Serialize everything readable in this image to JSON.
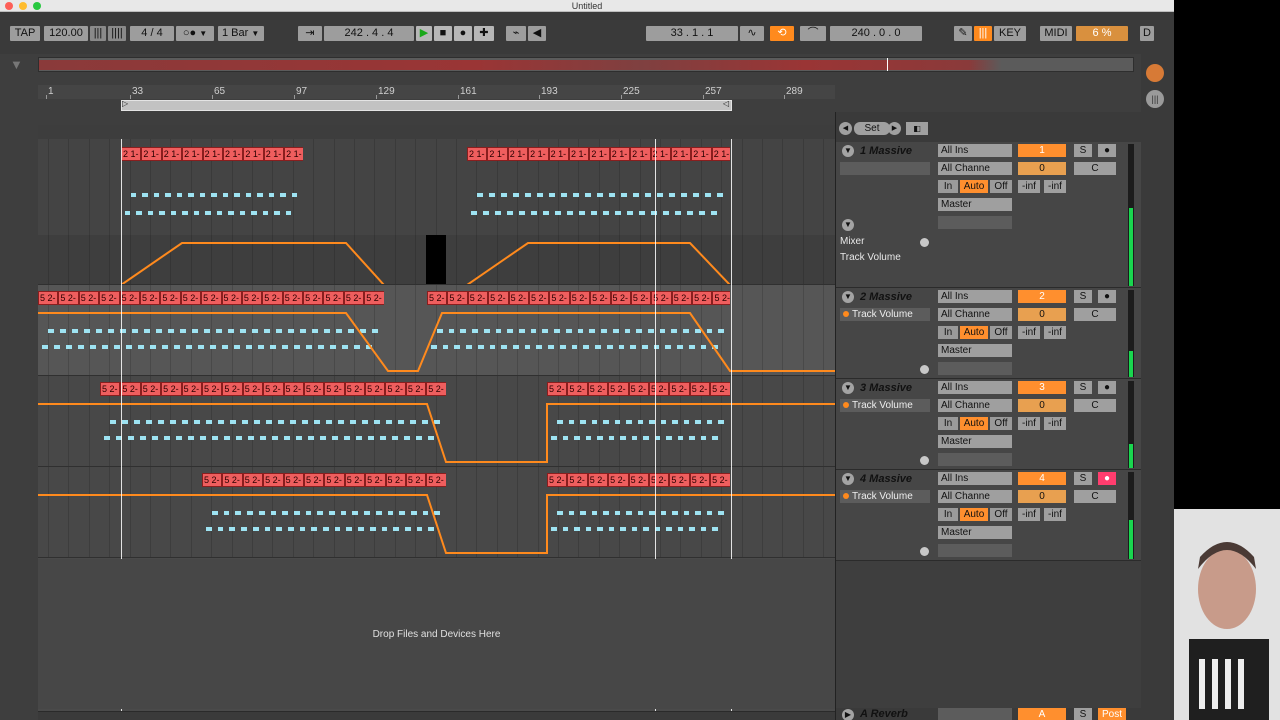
{
  "window": {
    "title": "Untitled"
  },
  "control_bar": {
    "tap": "TAP",
    "tempo": "120.00",
    "signature": "4 / 4",
    "metronome": "",
    "quantize": "1 Bar",
    "arrangement_position": "242 .  4 .  4",
    "punch_in": "33 .  1 .  1",
    "loop_length": "240 .  0 .  0",
    "key": "KEY",
    "midi": "MIDI",
    "cpu": "6 %",
    "d": "D"
  },
  "ruler": {
    "ticks": [
      "1",
      "33",
      "65",
      "97",
      "129",
      "161",
      "193",
      "225",
      "257",
      "289"
    ]
  },
  "tracks": [
    {
      "name": "1 Massive",
      "clip_label": "2 1-",
      "input": "All Ins",
      "channel": "All Channe",
      "monitor": [
        "In",
        "Auto",
        "Off"
      ],
      "output": "Master",
      "number": "1",
      "volume": "0",
      "pan": "C",
      "solo": "S",
      "peak_left": "-inf",
      "peak_right": "-inf",
      "automation_device": "Mixer",
      "automation_param": "Track Volume",
      "meter_level": 0.55,
      "arm_active": false
    },
    {
      "name": "2 Massive",
      "clip_label": "5 2-",
      "automation_param": "Track Volume",
      "input": "All Ins",
      "channel": "All Channe",
      "monitor": [
        "In",
        "Auto",
        "Off"
      ],
      "output": "Master",
      "number": "2",
      "volume": "0",
      "pan": "C",
      "solo": "S",
      "peak_left": "-inf",
      "peak_right": "-inf",
      "meter_level": 0.3,
      "arm_active": false
    },
    {
      "name": "3 Massive",
      "clip_label": "5 2-",
      "automation_param": "Track Volume",
      "input": "All Ins",
      "channel": "All Channe",
      "monitor": [
        "In",
        "Auto",
        "Off"
      ],
      "output": "Master",
      "number": "3",
      "volume": "0",
      "pan": "C",
      "solo": "S",
      "peak_left": "-inf",
      "peak_right": "-inf",
      "meter_level": 0.28,
      "arm_active": false
    },
    {
      "name": "4 Massive",
      "clip_label": "5 2-",
      "automation_param": "Track Volume",
      "input": "All Ins",
      "channel": "All Channe",
      "monitor": [
        "In",
        "Auto",
        "Off"
      ],
      "output": "Master",
      "number": "4",
      "volume": "0",
      "pan": "C",
      "solo": "S",
      "peak_left": "-inf",
      "peak_right": "-inf",
      "meter_level": 0.45,
      "arm_active": true
    }
  ],
  "return_track": {
    "name": "A Reverb",
    "letter": "A",
    "solo": "S",
    "post": "Post"
  },
  "mixer_top": {
    "set": "Set"
  },
  "drop_area": {
    "label": "Drop Files and Devices Here"
  },
  "colors": {
    "clip": "#ef5e5e",
    "automation": "#ff8a1d",
    "notes": "#9ee3f2",
    "meter": "#19d64f"
  }
}
